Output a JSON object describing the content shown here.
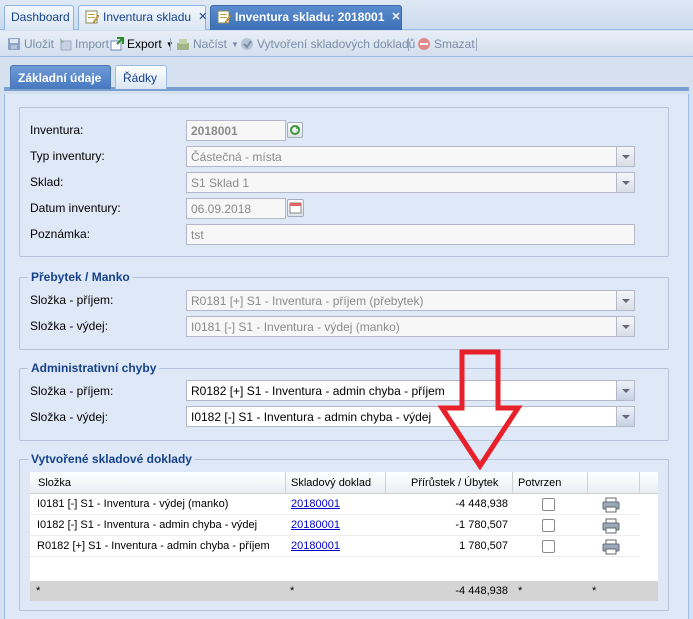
{
  "tabs": [
    {
      "label": "Dashboard"
    },
    {
      "label": "Inventura skladu"
    },
    {
      "label": "Inventura skladu: 2018001"
    }
  ],
  "toolbar": {
    "save": "Uložit",
    "import": "Import",
    "export": "Export",
    "load": "Načíst",
    "create_docs": "Vytvoření skladových dokladů",
    "delete": "Smazat"
  },
  "inner_tabs": [
    {
      "label": "Základní údaje"
    },
    {
      "label": "Řádky"
    }
  ],
  "basic": {
    "inventura_label": "Inventura:",
    "inventura_value": "2018001",
    "typ_label": "Typ inventury:",
    "typ_value": "Částečná - místa",
    "sklad_label": "Sklad:",
    "sklad_value": "S1 Sklad 1",
    "datum_label": "Datum inventury:",
    "datum_value": "06.09.2018",
    "poznamka_label": "Poznámka:",
    "poznamka_value": "tst"
  },
  "prebytek": {
    "legend": "Přebytek / Manko",
    "prijem_label": "Složka - příjem:",
    "prijem_value": "R0181 [+] S1 - Inventura - příjem (přebytek)",
    "vydej_label": "Složka - výdej:",
    "vydej_value": "I0181 [-] S1 - Inventura - výdej (manko)"
  },
  "admin": {
    "legend": "Administrativní chyby",
    "prijem_label": "Složka - příjem:",
    "prijem_value": "R0182 [+] S1 - Inventura - admin chyba - příjem",
    "vydej_label": "Složka - výdej:",
    "vydej_value": "I0182 [-] S1 - Inventura - admin chyba - výdej"
  },
  "docs": {
    "legend": "Vytvořené skladové doklady",
    "columns": [
      "Složka",
      "Skladový doklad",
      "Přírůstek / Úbytek",
      "Potvrzen"
    ],
    "rows": [
      {
        "slozka": "I0181 [-] S1 - Inventura - výdej (manko)",
        "doklad": "20180001",
        "value": "-4 448,938",
        "confirmed": false
      },
      {
        "slozka": "I0182 [-] S1 - Inventura - admin chyba - výdej",
        "doklad": "20180001",
        "value": "-1 780,507",
        "confirmed": false
      },
      {
        "slozka": "R0182 [+] S1 - Inventura - admin chyba - příjem",
        "doklad": "20180001",
        "value": "1 780,507",
        "confirmed": false
      }
    ],
    "footer": {
      "c1": "*",
      "c2": "*",
      "total": "-4 448,938",
      "c4": "*",
      "c5": "*"
    }
  },
  "colors": {
    "annotation_arrow": "#e8202a",
    "active_tab": "#4779c0"
  },
  "icons": {
    "print": "printer-icon"
  }
}
